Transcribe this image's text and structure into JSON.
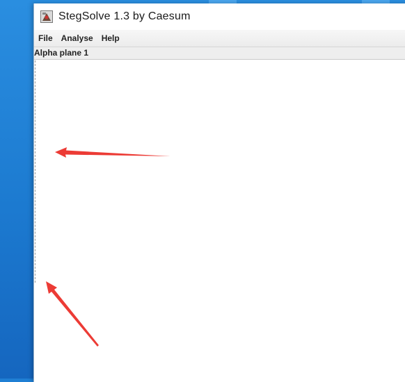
{
  "window": {
    "title": "StegSolve 1.3 by Caesum"
  },
  "menu": {
    "items": [
      "File",
      "Analyse",
      "Help"
    ]
  },
  "view": {
    "plane_label": "Alpha plane 1"
  },
  "colors": {
    "annotation_arrow": "#ec3b35",
    "desktop": "#1f7fd4"
  },
  "icons": {
    "app": "stegsolve-app-icon"
  }
}
